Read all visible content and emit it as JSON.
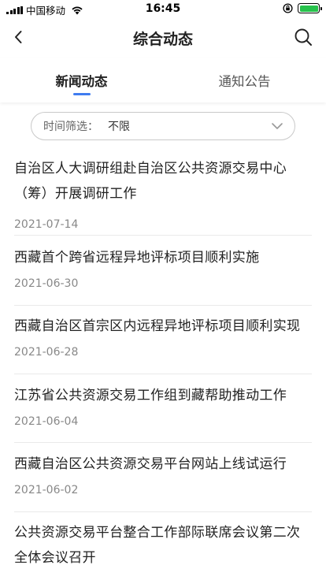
{
  "status_bar": {
    "carrier": "中国移动",
    "time": "16:45",
    "battery_color": "#27c24c"
  },
  "nav": {
    "title": "综合动态",
    "back_icon": "chevron-left-icon",
    "search_icon": "search-icon"
  },
  "tabs": [
    {
      "label": "新闻动态",
      "active": true
    },
    {
      "label": "通知公告",
      "active": false
    }
  ],
  "filter": {
    "label": "时间筛选：",
    "value": "不限"
  },
  "accent_color": "#3f7cf0",
  "news": [
    {
      "title": "自治区人大调研组赴自治区公共资源交易中心（筹）开展调研工作",
      "date": "2021-07-14"
    },
    {
      "title": "西藏首个跨省远程异地评标项目顺利实施",
      "date": "2021-06-30"
    },
    {
      "title": "西藏自治区首宗区内远程异地评标项目顺利实现",
      "date": "2021-06-28"
    },
    {
      "title": "江苏省公共资源交易工作组到藏帮助推动工作",
      "date": "2021-06-04"
    },
    {
      "title": "西藏自治区公共资源交易平台网站上线试运行",
      "date": "2021-06-02"
    },
    {
      "title": "公共资源交易平台整合工作部际联席会议第二次全体会议召开",
      "date": ""
    }
  ]
}
